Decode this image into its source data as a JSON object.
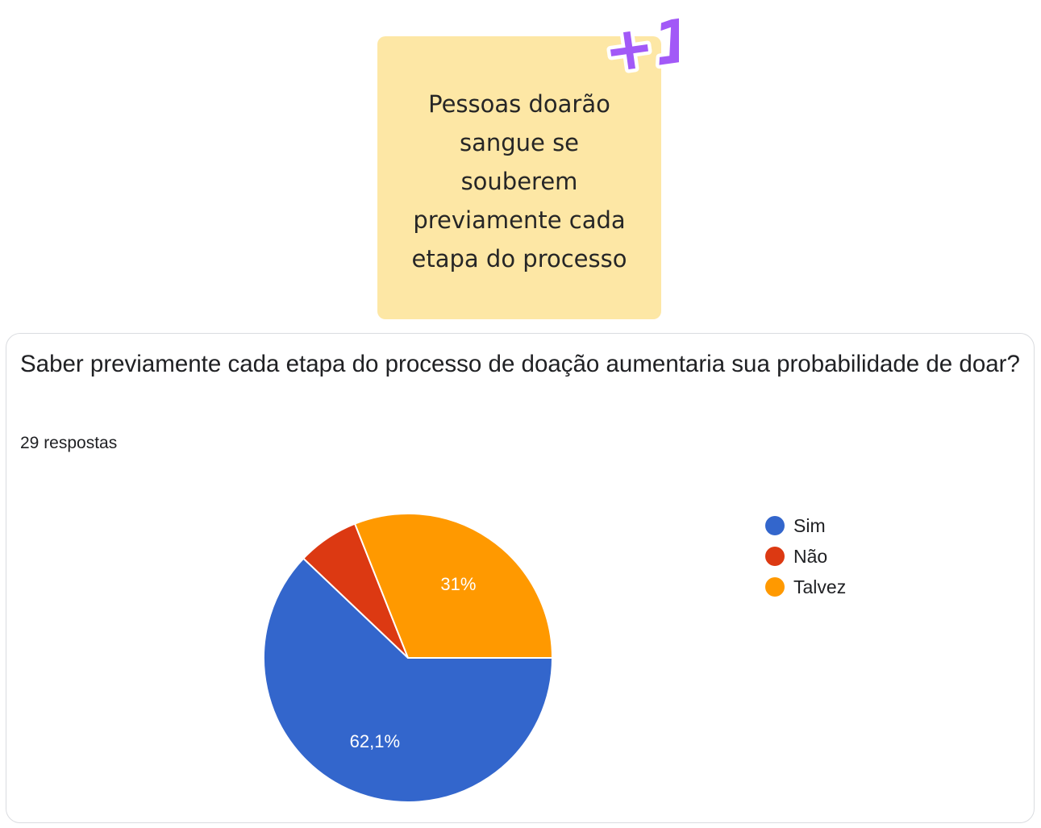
{
  "sticky_note": {
    "text": "Pessoas doarão\nsangue se\nsouberem\npreviamente cada\netapa do processo",
    "badge": "+1",
    "color": "#fde7a5",
    "badge_color": "#a259f7"
  },
  "card": {
    "question": "Saber previamente cada etapa do processo de doação aumentaria sua probabilidade de doar?",
    "responses": "29 respostas"
  },
  "chart_data": {
    "type": "pie",
    "categories": [
      "Sim",
      "Não",
      "Talvez"
    ],
    "values": [
      62.1,
      6.9,
      31.0
    ],
    "labels": [
      "62,1%",
      "",
      "31%"
    ],
    "colors": [
      "#3366cc",
      "#dc3912",
      "#ff9900"
    ],
    "legend_position": "right"
  }
}
